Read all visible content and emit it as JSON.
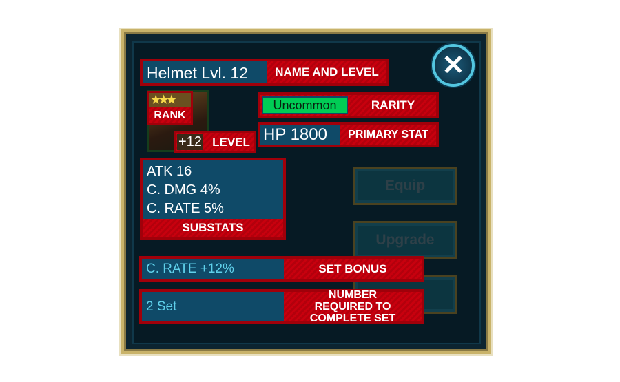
{
  "item": {
    "name_level": "Helmet Lvl. 12",
    "rarity": "Uncommon",
    "primary_stat": "HP 1800",
    "level": "+12",
    "stars": 3,
    "substats": [
      "ATK 16",
      "C. DMG 4%",
      "C. RATE 5%"
    ],
    "set_bonus": "C. RATE +12%",
    "set_count": "2 Set"
  },
  "labels": {
    "name_and_level": "NAME AND LEVEL",
    "rank": "RANK",
    "level": "LEVEL",
    "rarity": "RARITY",
    "primary_stat": "PRIMARY STAT",
    "substats": "SUBSTATS",
    "set_bonus": "SET BONUS",
    "number_required": "NUMBER REQUIRED TO COMPLETE SET"
  },
  "buttons": {
    "equip": "Equip",
    "upgrade": "Upgrade",
    "close": "✕"
  },
  "colors": {
    "annotation_red": "#c8000e",
    "stat_blue": "#0f4a68",
    "uncommon_green": "#00cc55",
    "frame_gold": "#c9b36a"
  }
}
